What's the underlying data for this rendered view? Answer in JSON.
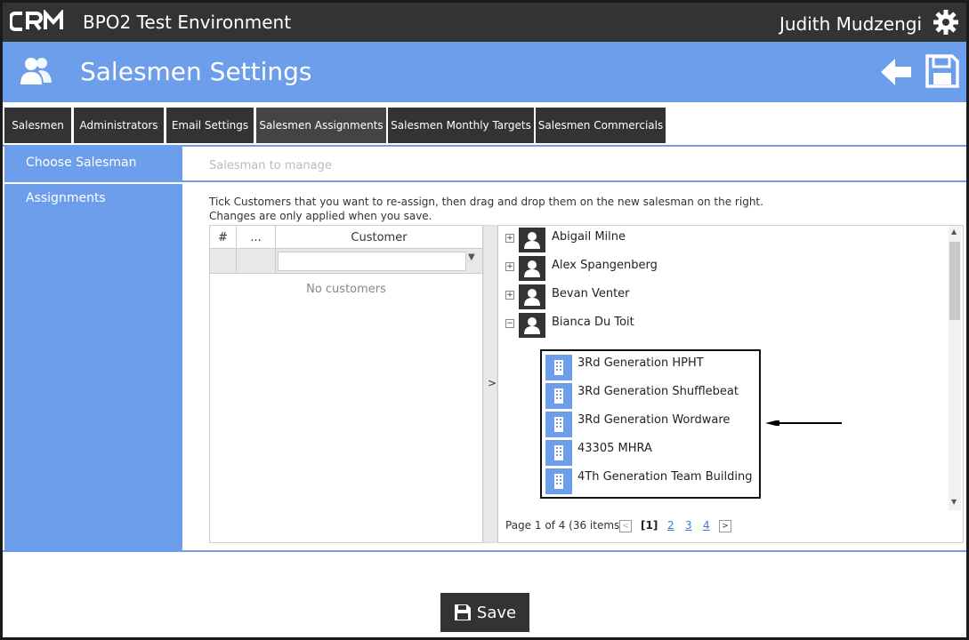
{
  "app": {
    "logo_text": "CRM",
    "environment_title": "BPO2 Test Environment",
    "user_name": "Judith Mudzengi"
  },
  "header": {
    "title": "Salesmen Settings"
  },
  "tabs": [
    {
      "label": "Salesmen"
    },
    {
      "label": "Administrators"
    },
    {
      "label": "Email Settings"
    },
    {
      "label": "Salesmen Assignments"
    },
    {
      "label": "Salesmen Monthly Targets"
    },
    {
      "label": "Salesmen Commercials"
    }
  ],
  "sidebar": {
    "items": [
      {
        "label": "Choose Salesman"
      },
      {
        "label": "Assignments"
      }
    ]
  },
  "salesman_picker": {
    "placeholder": "Salesman to manage"
  },
  "instructions": {
    "line1": "Tick Customers that you want to re-assign, then drag and drop them on the new salesman on the right.",
    "line2": "Changes are only applied when you save."
  },
  "customer_grid": {
    "columns": [
      "#",
      "...",
      "Customer"
    ],
    "empty_text": "No customers"
  },
  "splitter_label": ">",
  "tree": {
    "salesmen": [
      {
        "name": "Abigail Milne",
        "expander": "+"
      },
      {
        "name": "Alex Spangenberg",
        "expander": "+"
      },
      {
        "name": "Bevan Venter",
        "expander": "+"
      },
      {
        "name": "Bianca Du Toit",
        "expander": "−"
      }
    ],
    "customers": [
      {
        "name": "3Rd Generation HPHT"
      },
      {
        "name": "3Rd Generation Shufflebeat"
      },
      {
        "name": "3Rd Generation Wordware"
      },
      {
        "name": "43305 MHRA"
      },
      {
        "name": "4Th Generation Team Building"
      }
    ]
  },
  "pager": {
    "summary": "Page 1 of 4 (36 items)",
    "prev": "<",
    "next": ">",
    "pages": [
      "[1]",
      "2",
      "3",
      "4"
    ]
  },
  "footer": {
    "save_label": "Save"
  },
  "colors": {
    "accent": "#6d9eeb",
    "dark": "#333333"
  }
}
